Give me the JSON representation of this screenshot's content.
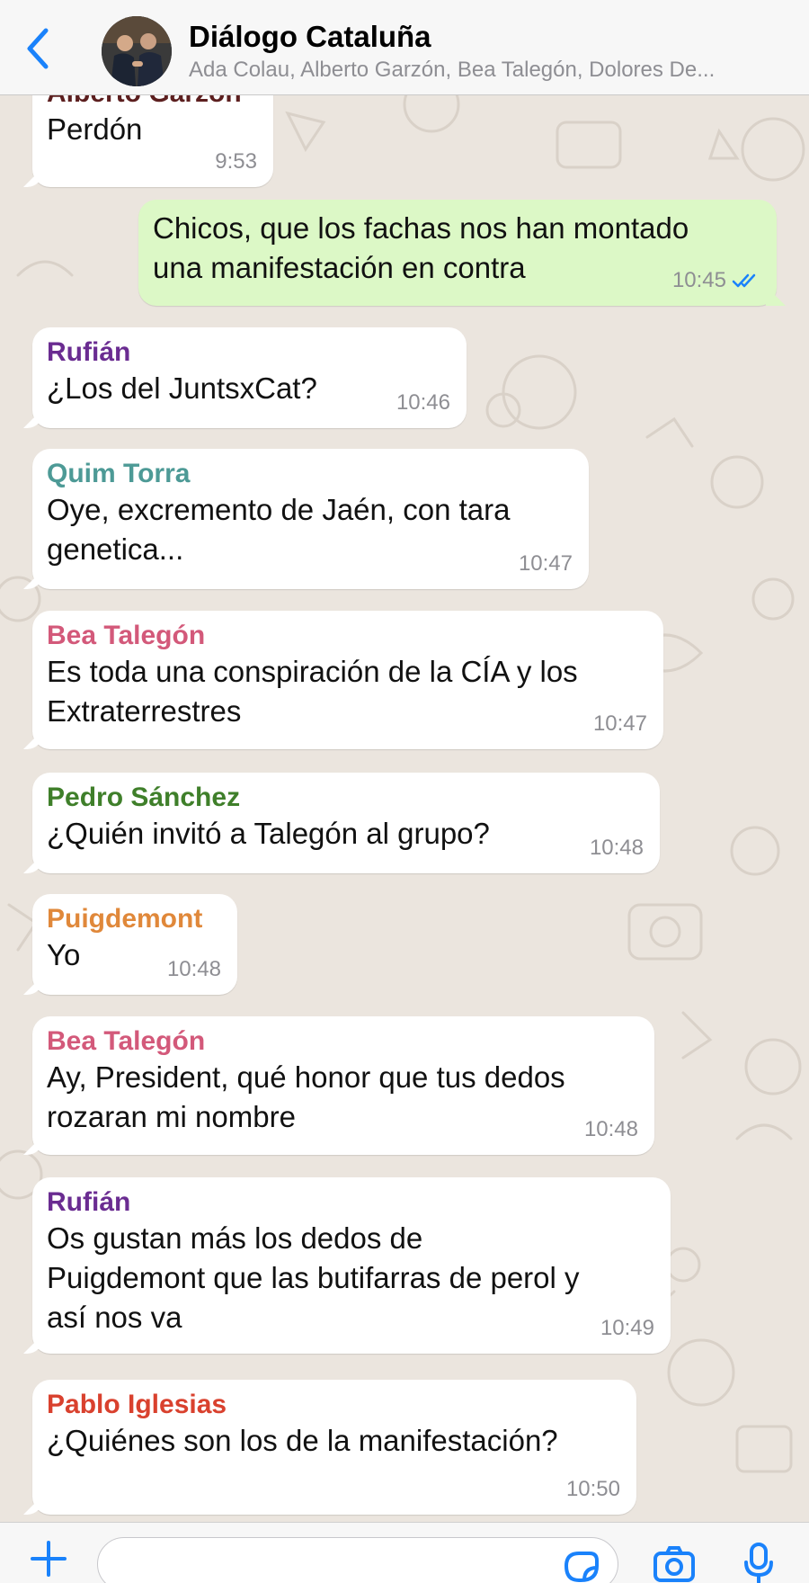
{
  "header": {
    "title": "Diálogo Cataluña",
    "subtitle": "Ada Colau, Alberto Garzón, Bea Talegón, Dolores De..."
  },
  "colors": {
    "accent": "#1a82fb",
    "outgoing_bubble": "#dcf8c6",
    "incoming_bubble": "#ffffff",
    "chat_background": "#ece5dd"
  },
  "messages": [
    {
      "sender": "Alberto Garzón",
      "sender_color": "#5c1f1f",
      "lines": [
        "Perdón"
      ],
      "time": "9:53"
    },
    {
      "sender": "",
      "lines": [
        "Chicos, que los fachas nos han montado",
        "una manifestación en contra"
      ],
      "time": "10:45",
      "outgoing": true,
      "status_icon": "double-check-icon"
    },
    {
      "sender": "Rufián",
      "sender_color": "#6a2c91",
      "lines": [
        "¿Los del JuntsxCat?"
      ],
      "time": "10:46"
    },
    {
      "sender": "Quim Torra",
      "sender_color": "#4d9a96",
      "lines": [
        "Oye, excremento de Jaén, con tara",
        "genetica..."
      ],
      "time": "10:47"
    },
    {
      "sender": "Bea Talegón",
      "sender_color": "#d3597a",
      "lines": [
        "Es toda una conspiración de la CÍA y los",
        "Extraterrestres"
      ],
      "time": "10:47"
    },
    {
      "sender": "Pedro Sánchez",
      "sender_color": "#3f7f2a",
      "lines": [
        "¿Quién invitó a Talegón al grupo?"
      ],
      "time": "10:48"
    },
    {
      "sender": "Puigdemont",
      "sender_color": "#e0883a",
      "lines": [
        "Yo"
      ],
      "time": "10:48"
    },
    {
      "sender": "Bea Talegón",
      "sender_color": "#d3597a",
      "lines": [
        "Ay, President, qué honor que tus dedos",
        "rozaran mi nombre"
      ],
      "time": "10:48"
    },
    {
      "sender": "Rufián",
      "sender_color": "#6a2c91",
      "lines": [
        "Os gustan más los dedos de",
        "Puigdemont que las butifarras de perol y",
        "así nos va"
      ],
      "time": "10:49"
    },
    {
      "sender": "Pablo Iglesias",
      "sender_color": "#d9412e",
      "lines": [
        "¿Quiénes son los de la manifestación?"
      ],
      "time": "10:50"
    }
  ],
  "input": {
    "icons": [
      "plus-icon",
      "sticker-icon",
      "camera-icon",
      "microphone-icon"
    ]
  }
}
